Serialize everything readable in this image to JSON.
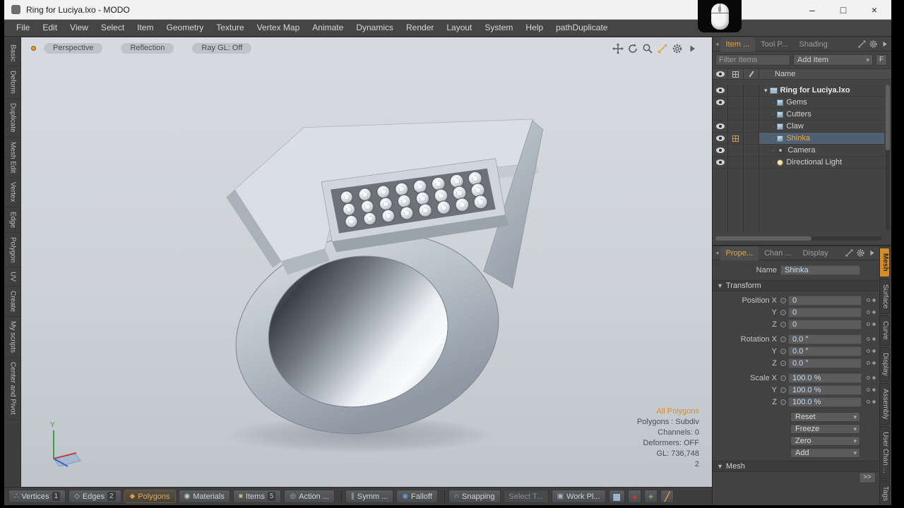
{
  "window": {
    "title": "Ring for Luciya.lxo - MODO",
    "controls": [
      {
        "name": "minimize-button",
        "glyph": "–"
      },
      {
        "name": "maximize-button",
        "glyph": "□"
      },
      {
        "name": "close-button",
        "glyph": "×"
      }
    ]
  },
  "menu": {
    "items": [
      "File",
      "Edit",
      "View",
      "Select",
      "Item",
      "Geometry",
      "Texture",
      "Vertex Map",
      "Animate",
      "Dynamics",
      "Render",
      "Layout",
      "System",
      "Help",
      "pathDuplicate"
    ]
  },
  "left_toolbar": {
    "tabs": [
      "Basic",
      "Deform",
      "Duplicate",
      "Mesh Edit",
      "Vertex",
      "Edge",
      "Polygon",
      "UV",
      "Create",
      "My scripts",
      "Center and Pivot"
    ]
  },
  "viewport": {
    "mode_buttons": [
      "Perspective",
      "Reflection",
      "Ray GL: Off"
    ],
    "stats": {
      "selection": "All Polygons",
      "lines": [
        "Polygons : Subdiv",
        "Channels: 0",
        "Deformers: OFF",
        "GL: 736,748",
        "2"
      ]
    },
    "axis_label_y": "Y"
  },
  "ring": {
    "gems": {
      "rows": 3,
      "cols": 8
    }
  },
  "item_panel": {
    "tabs": [
      {
        "label": "Item ...",
        "selected": true
      },
      {
        "label": "Tool P...",
        "selected": false
      },
      {
        "label": "Shading",
        "selected": false
      }
    ],
    "filter_placeholder": "Filter Items",
    "add_item_label": "Add Item",
    "f_button": "F",
    "name_header": "Name",
    "rows": [
      {
        "name": "Ring for Luciya.lxo",
        "icon": "scene",
        "eye": true,
        "root": true
      },
      {
        "name": "Gems",
        "icon": "mesh",
        "eye": true
      },
      {
        "name": "Cutters",
        "icon": "mesh",
        "eye": false
      },
      {
        "name": "Claw",
        "icon": "mesh",
        "eye": true
      },
      {
        "name": "Shinka",
        "icon": "mesh",
        "eye": true,
        "selected": true,
        "render_badge": true
      },
      {
        "name": "Camera",
        "icon": "camera",
        "eye": true
      },
      {
        "name": "Directional Light",
        "icon": "light",
        "eye": true
      }
    ]
  },
  "properties_panel": {
    "tabs": [
      {
        "label": "Prope...",
        "selected": true
      },
      {
        "label": "Chan ...",
        "selected": false
      },
      {
        "label": "Display",
        "selected": false
      }
    ],
    "name_label": "Name",
    "name_value": "Shinka",
    "transform_label": "Transform",
    "transform_rows": [
      {
        "label": "Position X",
        "value": "0",
        "group_start": true
      },
      {
        "label": "Y",
        "value": "0"
      },
      {
        "label": "Z",
        "value": "0"
      },
      {
        "label": "Rotation X",
        "value": "0.0 °",
        "group_start": true
      },
      {
        "label": "Y",
        "value": "0.0 °"
      },
      {
        "label": "Z",
        "value": "0.0 °"
      },
      {
        "label": "Scale X",
        "value": "100.0 %",
        "group_start": true
      },
      {
        "label": "Y",
        "value": "100.0 %"
      },
      {
        "label": "Z",
        "value": "100.0 %"
      }
    ],
    "action_buttons": [
      "Reset",
      "Freeze",
      "Zero",
      "Add"
    ],
    "mesh_label": "Mesh",
    "expand_button": ">>",
    "side_tabs": [
      {
        "label": "Mesh",
        "selected": true
      },
      {
        "label": "Surface",
        "selected": false
      },
      {
        "label": "Curve",
        "selected": false
      },
      {
        "label": "Display",
        "selected": false
      },
      {
        "label": "Assembly",
        "selected": false
      },
      {
        "label": "User Chan ...",
        "selected": false
      },
      {
        "label": "Tags",
        "selected": false
      }
    ]
  },
  "bottom_bar": {
    "buttons": [
      {
        "label": "Vertices",
        "badge": "1",
        "icon": "vertices"
      },
      {
        "label": "Edges",
        "badge": "2",
        "icon": "edges"
      },
      {
        "label": "Polygons",
        "icon": "polygons",
        "selected": true
      },
      {
        "label": "Materials",
        "icon": "materials"
      },
      {
        "label": "Items",
        "badge": "5",
        "icon": "items"
      },
      {
        "label": "Action ...",
        "icon": "action"
      },
      {
        "sep": true
      },
      {
        "label": "Symm ...",
        "icon": "symmetry"
      },
      {
        "label": "Falloff",
        "icon": "falloff"
      },
      {
        "sep": true
      },
      {
        "label": "Snapping",
        "icon": "snapping"
      },
      {
        "label": "Select T...",
        "disabled": true
      },
      {
        "label": "Work Pl...",
        "icon": "workplane"
      }
    ],
    "icon_glyphs": {
      "vertices": "∴",
      "edges": "◇",
      "polygons": "◆",
      "materials": "◉",
      "items": "■",
      "action": "◎",
      "symmetry": "∥",
      "falloff": "◉",
      "snapping": "∩",
      "workplane": "▣"
    },
    "icon_colors": {
      "vertices": "#b8c4cc",
      "edges": "#c0c4c8",
      "polygons": "#e89c2e",
      "materials": "#c8cdd2",
      "items": "#c2b183",
      "action": "#a9b0b6",
      "symmetry": "#b6bcc1",
      "falloff": "#5f9fd6",
      "snapping": "#b0b6ba",
      "workplane": "#9fb7c9"
    },
    "tool_icons": [
      {
        "name": "workplane-grid-icon",
        "glyph": "▦",
        "color": "#9fc2da"
      },
      {
        "name": "render-sphere-icon",
        "glyph": "●",
        "color": "#c23f38"
      },
      {
        "name": "axis-icon",
        "glyph": "+",
        "color": "#86b84e"
      },
      {
        "name": "paint-brush-icon",
        "glyph": "╱",
        "color": "#e09a38"
      }
    ]
  },
  "colors": {
    "accent": "#eda338",
    "selection_bg": "#4f6070",
    "value_text": "#c3dcf3",
    "viewport_top": "#d7dbdf",
    "viewport_bottom": "#bfc5cb"
  }
}
